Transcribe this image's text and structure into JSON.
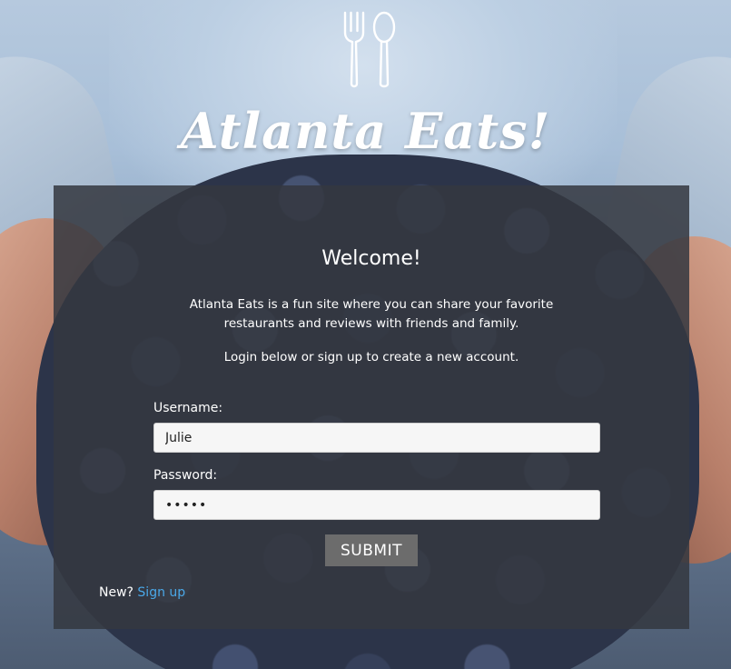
{
  "header": {
    "icon": "fork-and-spoon-icon",
    "title": "Atlanta Eats!"
  },
  "panel": {
    "heading": "Welcome!",
    "intro_lines": [
      "Atlanta Eats is a fun site where you can share your favorite",
      "restaurants and reviews with friends and family."
    ],
    "login_hint": "Login below or sign up to create a new account.",
    "username": {
      "label": "Username:",
      "value": "Julie"
    },
    "password": {
      "label": "Password:",
      "value": "•••••"
    },
    "submit_label": "SUBMIT",
    "signup": {
      "prompt": "New?",
      "link_label": "Sign up"
    }
  },
  "colors": {
    "panel_background": "#343840",
    "link": "#4aa8e8",
    "button": "#6c6c6c",
    "text": "#ffffff"
  }
}
